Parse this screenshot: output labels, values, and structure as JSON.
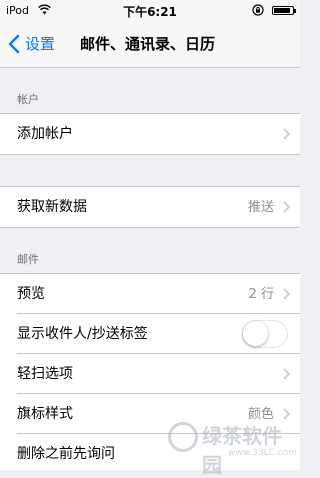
{
  "status_bar": {
    "carrier": "iPod",
    "time": "下午6:21"
  },
  "nav": {
    "back_label": "设置",
    "title": "邮件、通讯录、日历"
  },
  "sections": {
    "accounts_header": "帐户",
    "mail_header": "邮件"
  },
  "cells": {
    "add_account": "添加帐户",
    "fetch_new_data": {
      "label": "获取新数据",
      "value": "推送"
    },
    "preview": {
      "label": "预览",
      "value": "2 行"
    },
    "show_to_cc": {
      "label": "显示收件人/抄送标签",
      "toggle_on": false
    },
    "swipe_options": "轻扫选项",
    "flag_style": {
      "label": "旗标样式",
      "value": "颜色"
    },
    "ask_before_delete": "删除之前先询问"
  },
  "watermark": {
    "text": "绿茶软件园",
    "url": "www.33LC.com"
  },
  "colors": {
    "accent": "#007aff",
    "background": "#efeff4",
    "secondary_text": "#8e8e93"
  }
}
